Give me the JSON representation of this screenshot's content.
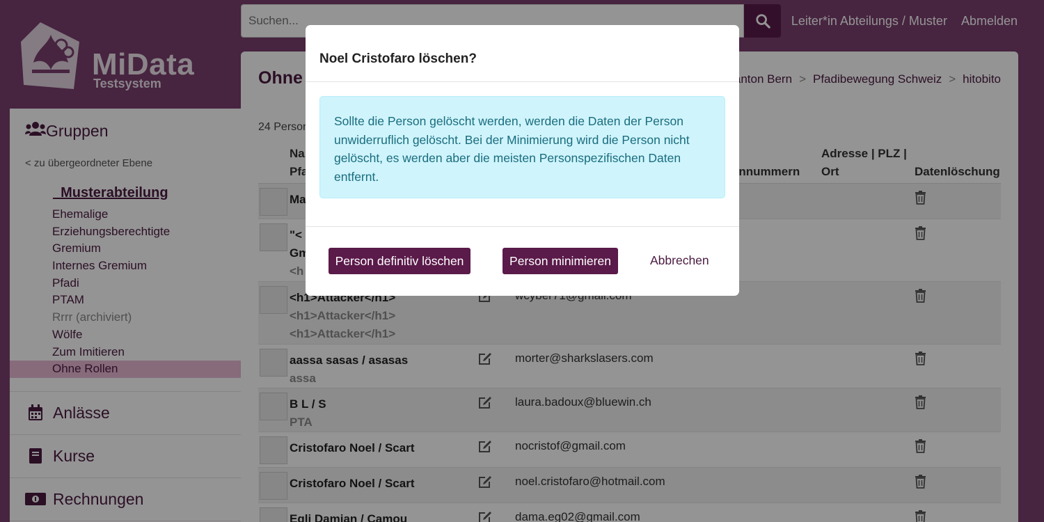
{
  "logo": {
    "title": "MiData",
    "subtitle": "Testsystem"
  },
  "search": {
    "placeholder": "Suchen..."
  },
  "topnav": {
    "role": "Leiter*in Abteilungs / Muster",
    "logout": "Abmelden"
  },
  "sidebar": {
    "groups_label": "Gruppen",
    "back_link": "< zu übergeordneter Ebene",
    "root": "_Musterabteilung",
    "items": [
      {
        "label": "Ehemalige"
      },
      {
        "label": "Erziehungsberechtigte"
      },
      {
        "label": "Gremium"
      },
      {
        "label": "Internes Gremium"
      },
      {
        "label": "Pfadi"
      },
      {
        "label": "PTAM"
      },
      {
        "label": "Rrrr (archiviert)"
      },
      {
        "label": "Wölfe"
      },
      {
        "label": "Zum Imitieren"
      },
      {
        "label": "Ohne Rollen"
      }
    ],
    "sections": [
      {
        "label": "Anlässe",
        "icon": "calendar-icon"
      },
      {
        "label": "Kurse",
        "icon": "book-icon"
      },
      {
        "label": "Rechnungen",
        "icon": "money-icon"
      }
    ]
  },
  "main": {
    "title": "Ohne",
    "breadcrumbs": [
      "anton Bern",
      "Pfadibewegung Schweiz",
      "hitobito"
    ],
    "breadcrumb_sep": ">",
    "count": "24 Person",
    "headers": {
      "name_line1": "Na",
      "name_line2": "Pfa",
      "phone": "onnummern",
      "address_line1": "Adresse | PLZ |",
      "address_line2": "Ort",
      "deletion": "Datenlöschung"
    },
    "rows": [
      {
        "name": "Ma",
        "sub": "",
        "sub2": "",
        "email": ""
      },
      {
        "name": "\"<",
        "sub": "Gm",
        "sub2": "<h",
        "email": ""
      },
      {
        "name": "<h1>Attacker</h1>",
        "sub": "<h1>Attacker</h1>",
        "sub2": "<h1>Attacker</h1>",
        "email": "wcyber71@gmail.com"
      },
      {
        "name": "aassa sasas / asasas",
        "sub": "assa",
        "sub2": "",
        "email": "morter@sharkslasers.com"
      },
      {
        "name": "B L / S",
        "sub": "PTA",
        "sub2": "",
        "email": "laura.badoux@bluewin.ch"
      },
      {
        "name": "Cristofaro Noel / Scart",
        "sub": "",
        "sub2": "",
        "email": "nocristof@gmail.com"
      },
      {
        "name": "Cristofaro Noel / Scart",
        "sub": "",
        "sub2": "",
        "email": "noel.cristofaro@hotmail.com"
      },
      {
        "name": "Egli Damian / Camou",
        "sub": "",
        "sub2": "",
        "email": "dama.eg02@gmail.com"
      }
    ]
  },
  "modal": {
    "title": "Noel Cristofaro löschen?",
    "info": "Sollte die Person gelöscht werden, werden die Daten der Person unwiderruflich gelöscht. Bei der Minimierung wird die Person nicht gelöscht, es werden aber die meisten Personspezifischen Daten entfernt.",
    "delete_button": "Person definitiv löschen",
    "minimize_button": "Person minimieren",
    "cancel_link": "Abbrechen"
  },
  "colors": {
    "brand": "#5a1a4a",
    "background": "#7a3f6e",
    "info_bg": "#cff4fc",
    "info_text": "#1a6d7e",
    "active_item": "#e8b8d4"
  }
}
